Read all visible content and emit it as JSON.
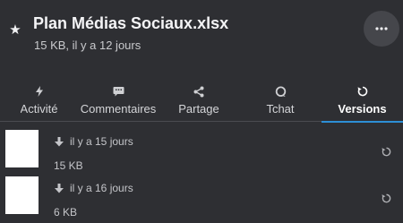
{
  "file": {
    "name": "Plan Médias Sociaux.xlsx",
    "meta": "15 KB, il y a 12 jours"
  },
  "icons": {
    "star": "star-icon",
    "more": "more-horizontal-icon",
    "activity": "bolt-icon",
    "comments": "comment-icon",
    "sharing": "share-icon",
    "chat": "chat-bubble-icon",
    "versions": "history-icon",
    "download": "arrow-down-icon",
    "restore": "restore-icon"
  },
  "colors": {
    "background": "#2e2f33",
    "active_tab_underline": "#2d8fd6",
    "thumbnail": "#ffffff"
  },
  "tabs": [
    {
      "label": "Activité",
      "active": false
    },
    {
      "label": "Commentaires",
      "active": false
    },
    {
      "label": "Partage",
      "active": false
    },
    {
      "label": "Tchat",
      "active": false
    },
    {
      "label": "Versions",
      "active": true
    }
  ],
  "versions": [
    {
      "date": "il y a 15 jours",
      "size": "15 KB"
    },
    {
      "date": "il y a 16 jours",
      "size": "6 KB"
    }
  ]
}
